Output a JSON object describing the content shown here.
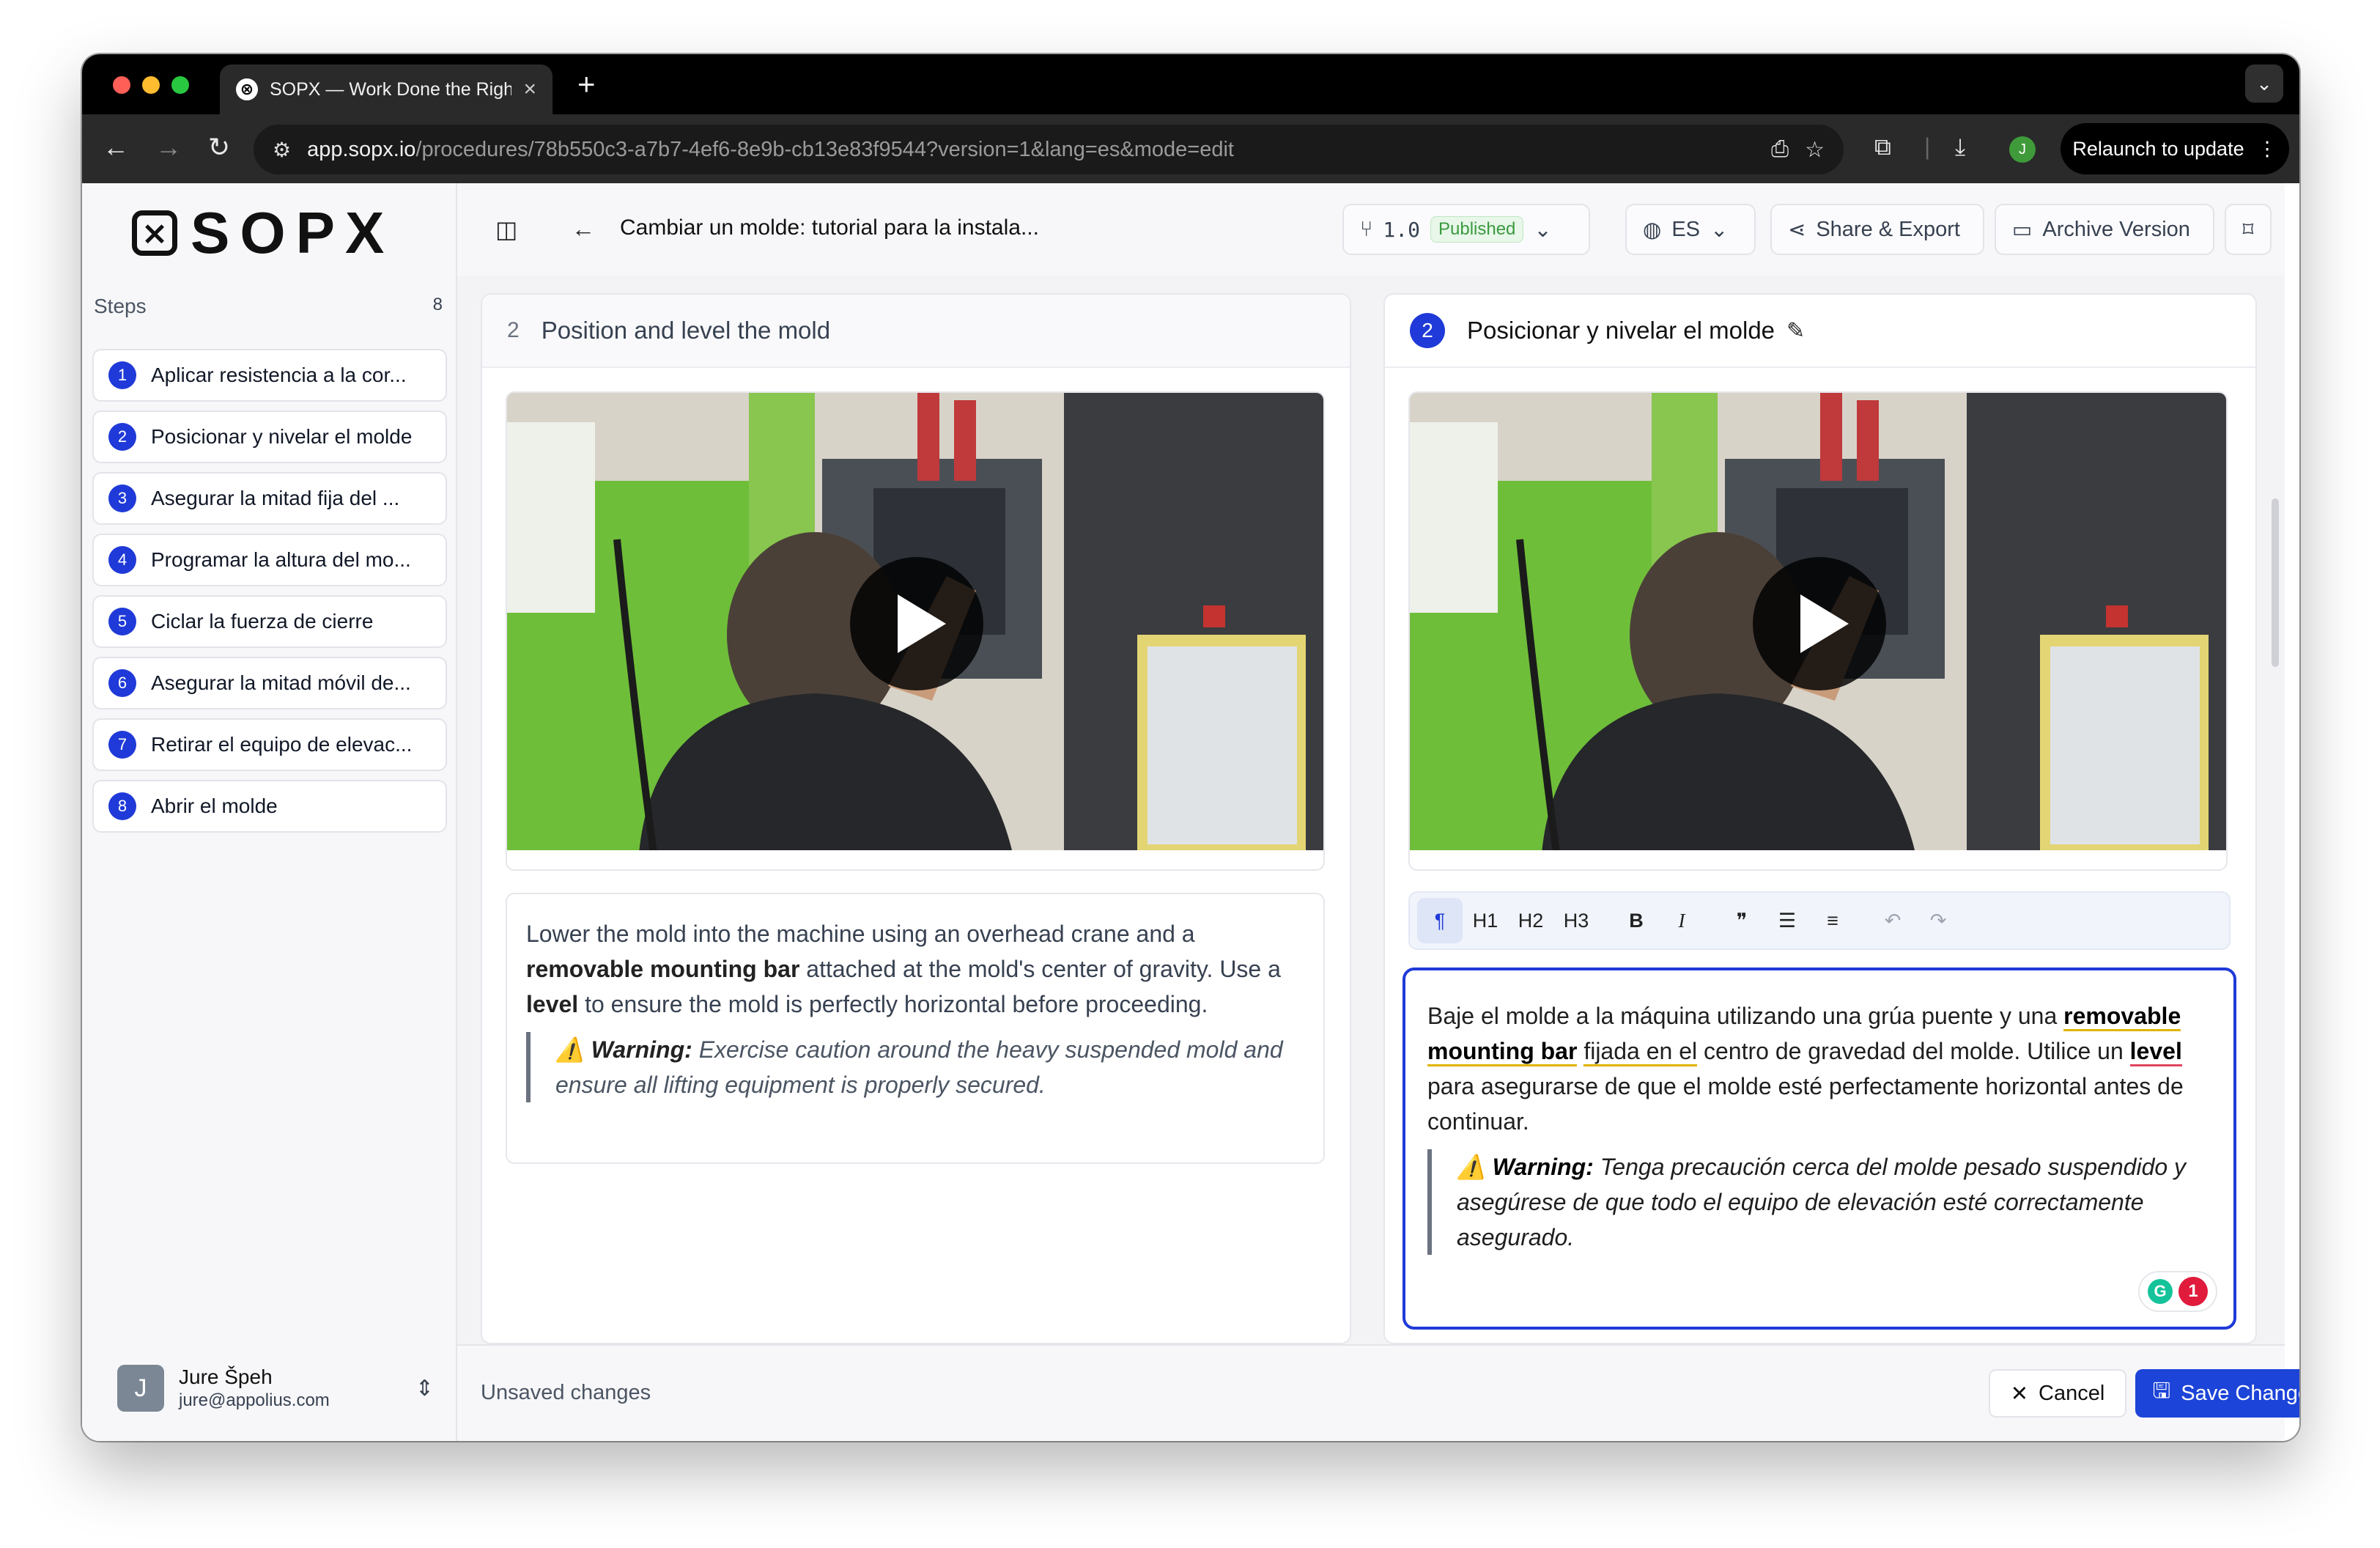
{
  "browser": {
    "tab_title": "SOPX — Work Done the Right Way",
    "url_host": "app.sopx.io",
    "url_path": "/procedures/78b550c3-a7b7-4ef6-8e9b-cb13e83f9544?version=1&lang=es&mode=edit",
    "relaunch_label": "Relaunch to update",
    "profile_initial": "J"
  },
  "app": {
    "logo_text": "SOPX",
    "page_title": "Cambiar un molde: tutorial para la instala...",
    "version": "1.0",
    "version_status": "Published",
    "language": "ES",
    "share_label": "Share & Export",
    "archive_label": "Archive Version"
  },
  "sidebar": {
    "steps_label": "Steps",
    "steps_count": "8",
    "steps": [
      {
        "num": "1",
        "label": "Aplicar resistencia a la cor..."
      },
      {
        "num": "2",
        "label": "Posicionar y nivelar el molde"
      },
      {
        "num": "3",
        "label": "Asegurar la mitad fija del ..."
      },
      {
        "num": "4",
        "label": "Programar la altura del mo..."
      },
      {
        "num": "5",
        "label": "Ciclar la fuerza de cierre"
      },
      {
        "num": "6",
        "label": "Asegurar la mitad móvil de..."
      },
      {
        "num": "7",
        "label": "Retirar el equipo de elevac..."
      },
      {
        "num": "8",
        "label": "Abrir el molde"
      }
    ],
    "user": {
      "initial": "J",
      "name": "Jure Špeh",
      "email": "jure@appolius.com"
    }
  },
  "source_panel": {
    "step_num": "2",
    "title": "Position and level the mold",
    "text_1": "Lower the mold into the machine using an overhead crane and a ",
    "bold_1": "removable mounting bar",
    "text_2": " attached at the mold's center of gravity. Use a ",
    "bold_2": "level",
    "text_3": " to ensure the mold is perfectly horizontal before proceeding.",
    "warning_label": "Warning:",
    "warning_text": " Exercise caution around the heavy suspended mold and ensure all lifting equipment is properly secured."
  },
  "target_panel": {
    "step_num": "2",
    "title": "Posicionar y nivelar el molde",
    "text_1": "Baje el molde a la máquina utilizando una grúa puente y una ",
    "bold_1": "removable mounting bar",
    "text_2a": " ",
    "text_2b": "fijada en el",
    "text_2c": " centro de gravedad del molde. Utilice un ",
    "bold_2": "level",
    "text_3": " para asegurarse de que el molde esté perfectamente horizontal antes de continuar.",
    "warning_label": "Warning:",
    "warning_text": " Tenga precaución cerca del molde pesado suspendido y asegúrese de que todo el equipo de elevación esté correctamente asegurado.",
    "grammar_count": "1"
  },
  "editor_toolbar": {
    "paragraph": "¶",
    "h1": "H1",
    "h2": "H2",
    "h3": "H3",
    "bold": "B",
    "italic": "I",
    "quote": "❞",
    "bullet": "☰",
    "ordered": "≡",
    "undo": "↶",
    "redo": "↷"
  },
  "footer": {
    "status": "Unsaved changes",
    "cancel_label": "Cancel",
    "save_label": "Save Changes"
  },
  "colors": {
    "accent": "#1d44d8",
    "published_green": "#3a9a3f",
    "machine_green": "#6fbe3a"
  }
}
